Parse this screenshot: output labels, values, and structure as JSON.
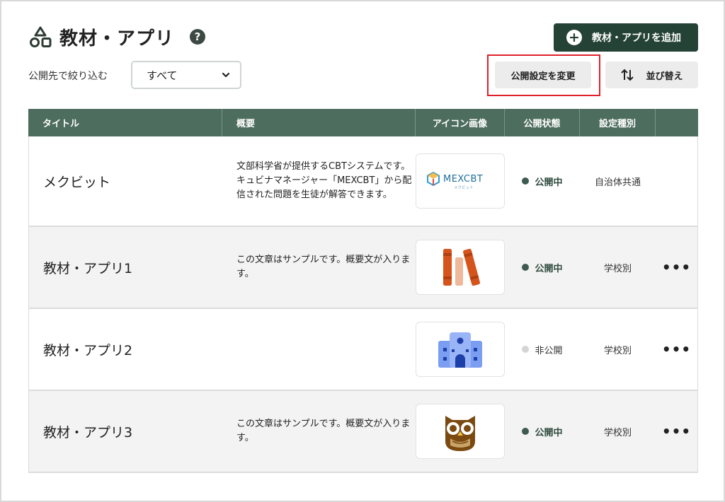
{
  "page": {
    "title": "教材・アプリ",
    "help": "?"
  },
  "toolbar": {
    "add_label": "教材・アプリを追加",
    "filter_label": "公開先で絞り込む",
    "filter_value": "すべて",
    "publish_label": "公開設定を変更",
    "sort_label": "並び替え"
  },
  "table": {
    "headers": [
      "タイトル",
      "概要",
      "アイコン画像",
      "公開状態",
      "設定種別",
      ""
    ],
    "rows": [
      {
        "title": "メクビット",
        "summary": "文部科学省が提供するCBTシステムです。キュビナマネージャー「MEXCBT」から配信された問題を生徒が解答できます。",
        "icon": "mexcbt-logo",
        "logo_text": "MEXCBT",
        "logo_sub": "メクビット",
        "status": "公開中",
        "type": "自治体共通",
        "menu": ""
      },
      {
        "title": "教材・アプリ1",
        "summary": "この文章はサンプルです。概要文が入ります。",
        "icon": "books-icon",
        "status": "公開中",
        "type": "学校別",
        "menu": "•••"
      },
      {
        "title": "教材・アプリ2",
        "summary": "",
        "icon": "school-building-icon",
        "status": "非公開",
        "type": "学校別",
        "menu": "•••"
      },
      {
        "title": "教材・アプリ3",
        "summary": "この文章はサンプルです。概要文が入ります。",
        "icon": "owl-icon",
        "status": "公開中",
        "type": "学校別",
        "menu": "•••"
      }
    ]
  },
  "colors": {
    "primary": "#244236",
    "header": "#4d6d5e",
    "highlight": "#e0202a",
    "books": "#d4541c",
    "school": "#7b9ef2",
    "owl": "#7a4a10"
  }
}
